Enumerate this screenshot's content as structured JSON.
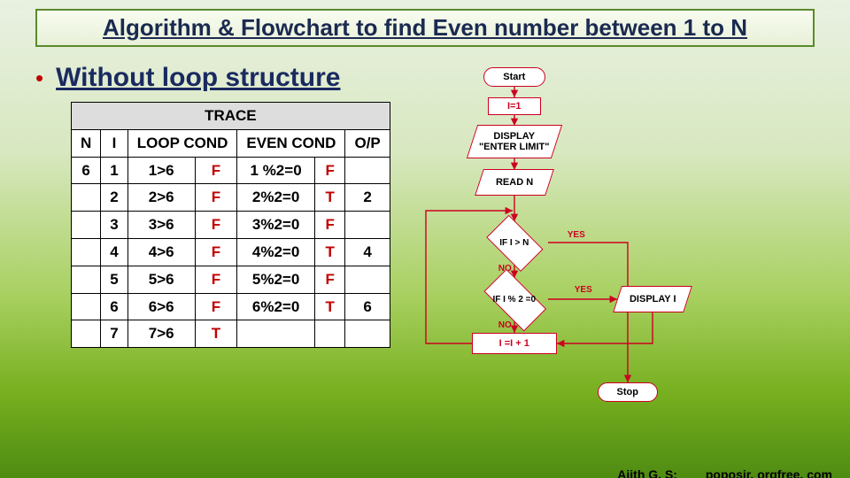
{
  "title": "Algorithm & Flowchart to find Even number between 1 to N",
  "bullet": "Without loop structure",
  "trace": {
    "title": "TRACE",
    "headers": {
      "n": "N",
      "i": "I",
      "loop": "LOOP COND",
      "even": "EVEN COND",
      "op": "O/P"
    },
    "n_value": "6",
    "rows": [
      {
        "i": "1",
        "loop": "1>6",
        "lres": "F",
        "even": "1 %2=0",
        "eres": "F",
        "op": ""
      },
      {
        "i": "2",
        "loop": "2>6",
        "lres": "F",
        "even": "2%2=0",
        "eres": "T",
        "op": "2"
      },
      {
        "i": "3",
        "loop": "3>6",
        "lres": "F",
        "even": "3%2=0",
        "eres": "F",
        "op": ""
      },
      {
        "i": "4",
        "loop": "4>6",
        "lres": "F",
        "even": "4%2=0",
        "eres": "T",
        "op": "4"
      },
      {
        "i": "5",
        "loop": "5>6",
        "lres": "F",
        "even": "5%2=0",
        "eres": "F",
        "op": ""
      },
      {
        "i": "6",
        "loop": "6>6",
        "lres": "F",
        "even": "6%2=0",
        "eres": "T",
        "op": "6"
      },
      {
        "i": "7",
        "loop": "7>6",
        "lres": "T",
        "even": "",
        "eres": "",
        "op": ""
      }
    ]
  },
  "flowchart": {
    "start": "Start",
    "init": "I=1",
    "display_prompt": "DISPLAY\n\"ENTER LIMIT\"",
    "read": "READ N",
    "cond1": "IF I > N",
    "cond2": "IF I % 2 =0",
    "display_i": "DISPLAY I",
    "inc": "I =I + 1",
    "stop": "Stop",
    "yes": "YES",
    "no": "NO"
  },
  "footer": {
    "author": "Ajith G. S:",
    "site": "poposir. orgfree. com"
  }
}
